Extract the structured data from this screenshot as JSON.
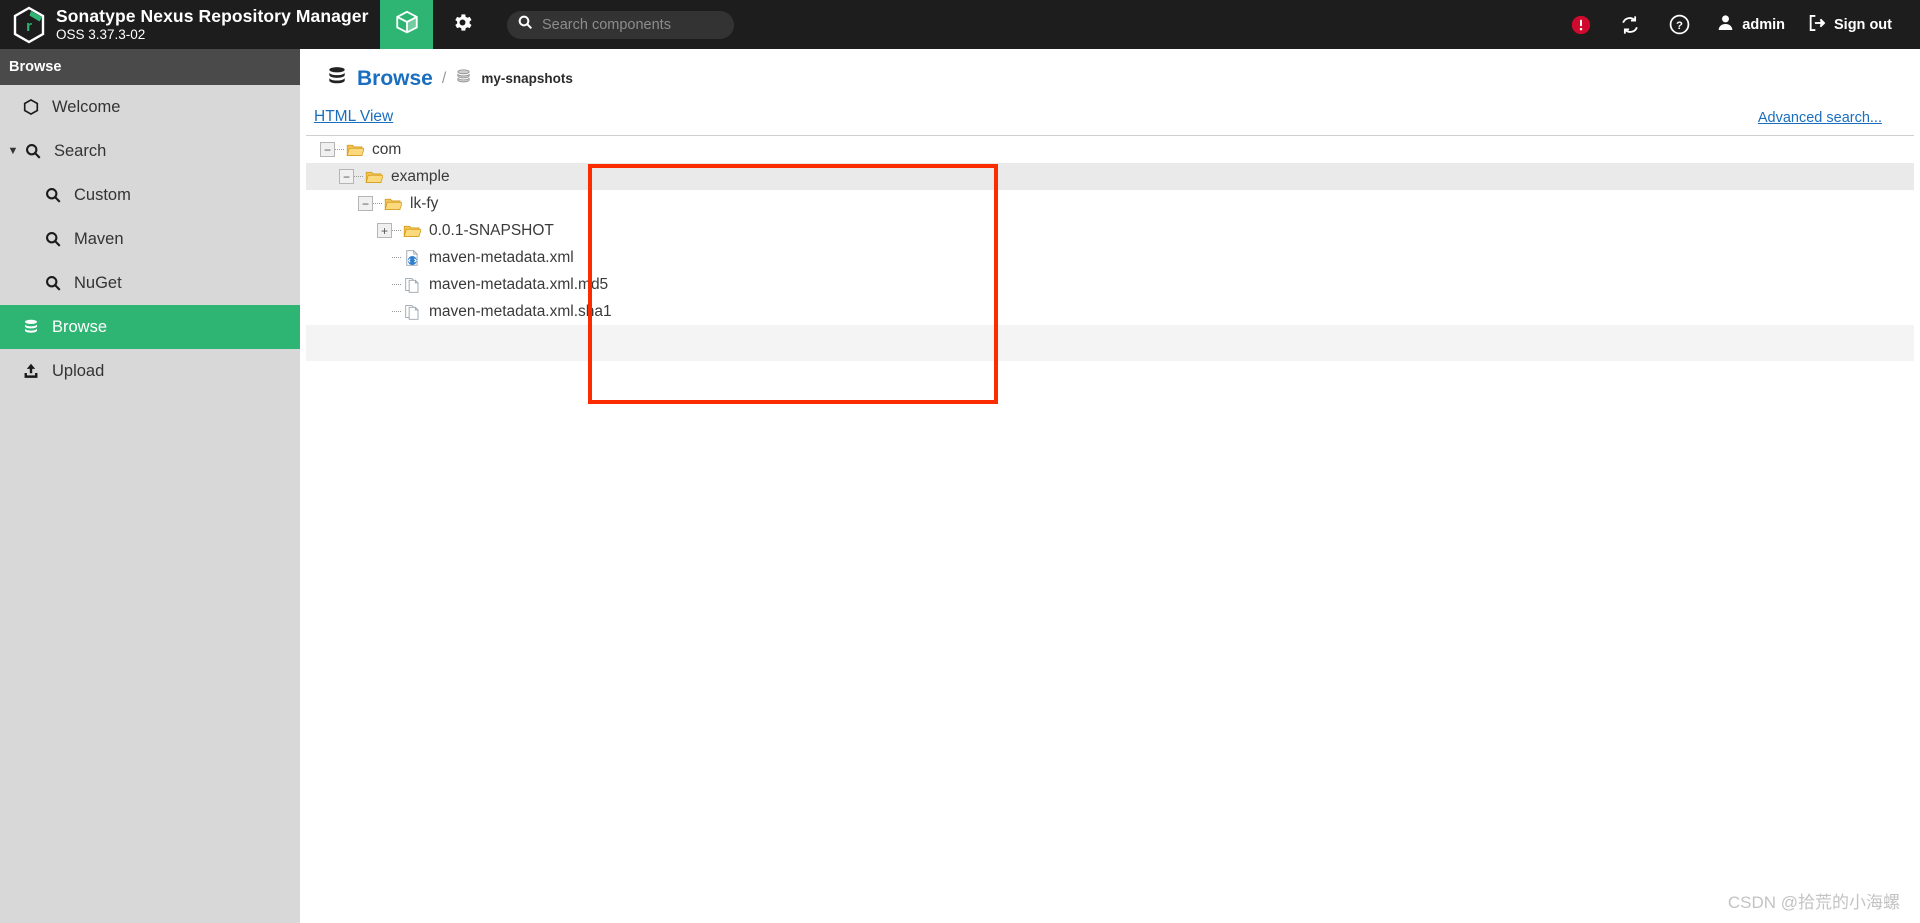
{
  "header": {
    "brand_title": "Sonatype Nexus Repository Manager",
    "brand_version": "OSS 3.37.3-02",
    "logo_icon": "nexus-hexagon-logo",
    "tabs": [
      {
        "icon": "cube-icon",
        "name": "browse-tab",
        "active": true
      },
      {
        "icon": "gear-icon",
        "name": "admin-tab",
        "active": false
      }
    ],
    "search": {
      "icon": "search-icon",
      "placeholder": "Search components",
      "value": ""
    },
    "alert_icon": "alert-circle-icon",
    "refresh_icon": "refresh-sync-icon",
    "help_icon": "help-question-icon",
    "user_icon": "user-avatar-icon",
    "user_label": "admin",
    "signout_icon": "sign-out-icon",
    "signout_label": "Sign out",
    "alert_color": "#cf0a2c",
    "accent_color": "#2fb573",
    "background_color": "#1d1d1d"
  },
  "sidebar": {
    "title": "Browse",
    "items": [
      {
        "label": "Welcome",
        "icon": "hexagon-icon",
        "level": 1,
        "active": false,
        "caret": ""
      },
      {
        "label": "Search",
        "icon": "search-icon",
        "level": 1,
        "active": false,
        "caret": "▼"
      },
      {
        "label": "Custom",
        "icon": "search-icon",
        "level": 2,
        "active": false,
        "caret": ""
      },
      {
        "label": "Maven",
        "icon": "search-icon",
        "level": 2,
        "active": false,
        "caret": ""
      },
      {
        "label": "NuGet",
        "icon": "search-icon",
        "level": 2,
        "active": false,
        "caret": ""
      },
      {
        "label": "Browse",
        "icon": "database-icon",
        "level": 1,
        "active": true,
        "caret": ""
      },
      {
        "label": "Upload",
        "icon": "upload-icon",
        "level": 1,
        "active": false,
        "caret": ""
      }
    ]
  },
  "main": {
    "breadcrumb": {
      "root_icon": "database-icon",
      "root_label": "Browse",
      "separator": "/",
      "current_icon": "repository-icon",
      "current_label": "my-snapshots"
    },
    "html_view_label": "HTML View",
    "advanced_search_label": "Advanced search...",
    "tree": [
      {
        "label": "com",
        "depth": 0,
        "toggle": "−",
        "icon": "folder-open-icon",
        "alt": false
      },
      {
        "label": "example",
        "depth": 1,
        "toggle": "−",
        "icon": "folder-open-icon",
        "alt": true
      },
      {
        "label": "lk-fy",
        "depth": 2,
        "toggle": "−",
        "icon": "folder-open-icon",
        "alt": false
      },
      {
        "label": "0.0.1-SNAPSHOT",
        "depth": 3,
        "toggle": "+",
        "icon": "folder-open-icon",
        "alt": false
      },
      {
        "label": "maven-metadata.xml",
        "depth": 3,
        "toggle": "",
        "icon": "xml-file-icon",
        "alt": false
      },
      {
        "label": "maven-metadata.xml.md5",
        "depth": 3,
        "toggle": "",
        "icon": "file-icon",
        "alt": false
      },
      {
        "label": "maven-metadata.xml.sha1",
        "depth": 3,
        "toggle": "",
        "icon": "file-icon",
        "alt": false
      }
    ]
  },
  "annotation": {
    "shape": "rectangle",
    "color": "#fb2c00"
  },
  "watermark": {
    "text": "CSDN @拾荒的小海螺"
  }
}
